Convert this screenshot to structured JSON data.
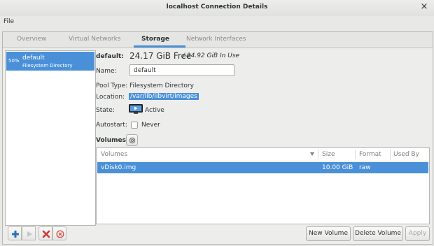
{
  "window": {
    "title": "localhost Connection Details",
    "close_glyph": "×"
  },
  "menu": {
    "file": "File"
  },
  "tabs": [
    {
      "label": "Overview",
      "active": false
    },
    {
      "label": "Virtual Networks",
      "active": false
    },
    {
      "label": "Storage",
      "active": true
    },
    {
      "label": "Network Interfaces",
      "active": false
    }
  ],
  "pools": [
    {
      "percent": "50%",
      "name": "default",
      "type": "Filesystem Directory",
      "selected": true
    }
  ],
  "details": {
    "pool_label": "default:",
    "free": "24.17 GiB Free",
    "in_use": "/ 24.92 GiB In Use",
    "name_label": "Name:",
    "name_value": "default",
    "pool_type_label": "Pool Type:",
    "pool_type_value": "Filesystem Directory",
    "location_label": "Location:",
    "location_value": "/var/lib/libvirt/images",
    "state_label": "State:",
    "state_value": "Active",
    "autostart_label": "Autostart:",
    "autostart_value": "Never",
    "autostart_checked": false,
    "volumes_label": "Volumes"
  },
  "volumes_table": {
    "headers": {
      "volumes": "Volumes",
      "size": "Size",
      "format": "Format",
      "used_by": "Used By"
    },
    "rows": [
      {
        "name": "vDisk0.img",
        "size": "10.00 GiB",
        "format": "raw",
        "used_by": ""
      }
    ]
  },
  "buttons": {
    "new_volume": "New Volume",
    "delete_volume": "Delete Volume",
    "apply": "Apply"
  },
  "icons": {
    "add_pool": "plus-icon",
    "start_pool": "play-icon",
    "delete_pool": "delete-x-icon",
    "stop_pool": "stop-icon",
    "refresh": "refresh-icon",
    "state": "monitor-icon"
  },
  "colors": {
    "selection": "#4a90d9",
    "delete_red": "#cc3a3a",
    "add_blue": "#2a6fb8"
  }
}
